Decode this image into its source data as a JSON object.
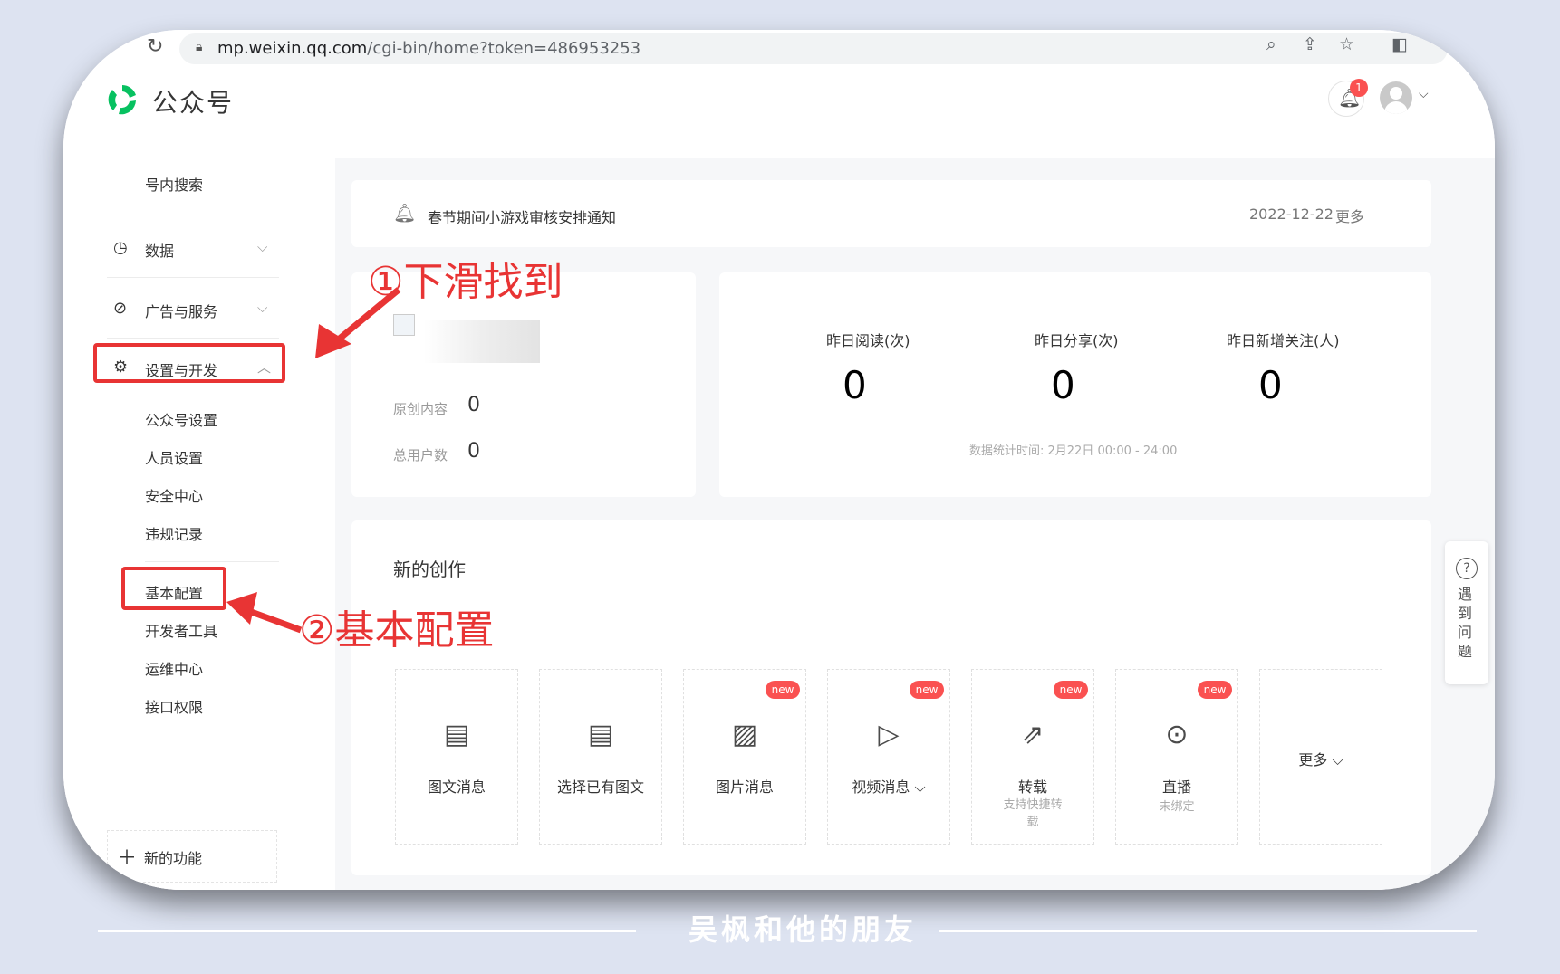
{
  "browser": {
    "url_domain": "mp.weixin.qq.com",
    "url_rest": "/cgi-bin/home?token=486953253"
  },
  "header": {
    "brand": "公众号",
    "notification_count": "1"
  },
  "sidebar": {
    "search": "号内搜索",
    "data": "数据",
    "ads": "广告与服务",
    "settings": "设置与开发",
    "settings_sub": [
      "公众号设置",
      "人员设置",
      "安全中心",
      "违规记录"
    ],
    "dev_sub": [
      "基本配置",
      "开发者工具",
      "运维中心",
      "接口权限"
    ],
    "new_feature": "新的功能"
  },
  "notice": {
    "text": "春节期间小游戏审核安排通知",
    "date": "2022-12-22",
    "more": "更多"
  },
  "account": {
    "original_label": "原创内容",
    "original_value": "0",
    "users_label": "总用户数",
    "users_value": "0"
  },
  "stats": {
    "items": [
      {
        "label": "昨日阅读(次)",
        "value": "0"
      },
      {
        "label": "昨日分享(次)",
        "value": "0"
      },
      {
        "label": "昨日新增关注(人)",
        "value": "0"
      }
    ],
    "footnote": "数据统计时间: 2月22日 00:00 - 24:00"
  },
  "create": {
    "title": "新的创作",
    "new_badge": "new",
    "tiles": [
      {
        "label": "图文消息",
        "sub": ""
      },
      {
        "label": "选择已有图文",
        "sub": ""
      },
      {
        "label": "图片消息",
        "sub": ""
      },
      {
        "label": "视频消息 ⌵",
        "sub": ""
      },
      {
        "label": "转载",
        "sub": "支持快捷转\n载"
      },
      {
        "label": "直播",
        "sub": "未绑定"
      },
      {
        "label": "更多 ⌵",
        "sub": ""
      }
    ]
  },
  "help": {
    "text": "遇到问题"
  },
  "annotations": {
    "step1": "①下滑找到",
    "step2": "②基本配置"
  },
  "watermark": "吴枫和他的朋友",
  "colors": {
    "accent_red": "#e83434",
    "brand_green": "#07c160",
    "badge_red": "#fa5151"
  }
}
